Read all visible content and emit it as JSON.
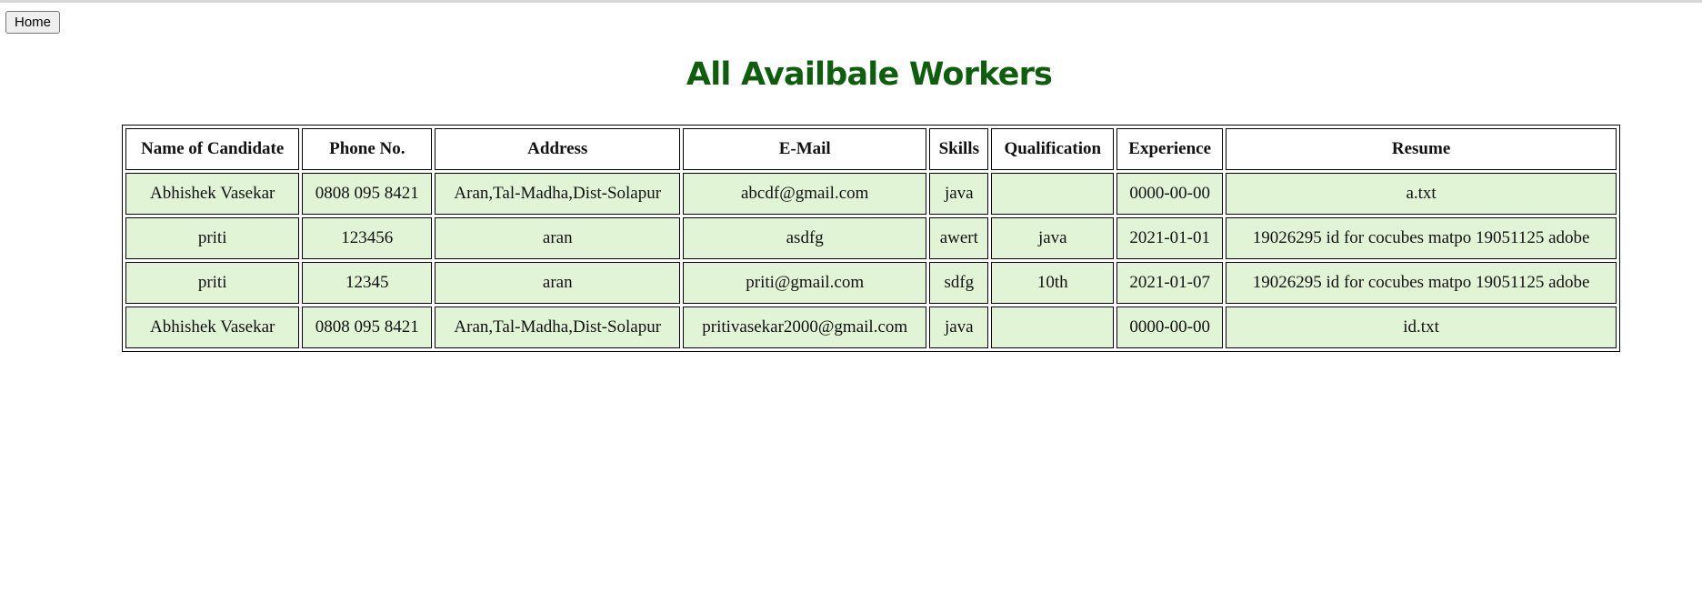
{
  "nav": {
    "home_label": "Home"
  },
  "page": {
    "title": "All Availbale Workers"
  },
  "table": {
    "columns": [
      "Name of Candidate",
      "Phone No.",
      "Address",
      "E-Mail",
      "Skills",
      "Qualification",
      "Experience",
      "Resume"
    ],
    "rows": [
      [
        "Abhishek Vasekar",
        "0808 095 8421",
        "Aran,Tal-Madha,Dist-Solapur",
        "abcdf@gmail.com",
        "java",
        "",
        "0000-00-00",
        "a.txt"
      ],
      [
        "priti",
        "123456",
        "aran",
        "asdfg",
        "awert",
        "java",
        "2021-01-01",
        "19026295 id for cocubes matpo 19051125 adobe"
      ],
      [
        "priti",
        "12345",
        "aran",
        "priti@gmail.com",
        "sdfg",
        "10th",
        "2021-01-07",
        "19026295 id for cocubes matpo 19051125 adobe"
      ],
      [
        "Abhishek Vasekar",
        "0808 095 8421",
        "Aran,Tal-Madha,Dist-Solapur",
        "pritivasekar2000@gmail.com",
        "java",
        "",
        "0000-00-00",
        "id.txt"
      ]
    ]
  },
  "colors": {
    "title": "#0e5e0e",
    "row_background": "#e2f4d6"
  }
}
